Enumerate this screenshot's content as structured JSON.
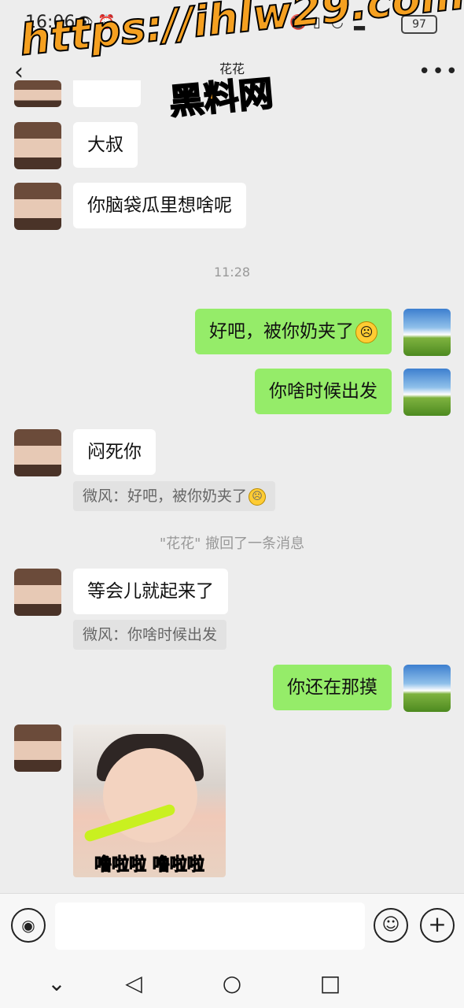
{
  "status_bar": {
    "time": "16:06",
    "battery": "97"
  },
  "header": {
    "title": "花花",
    "back_icon": "chevron-left-icon",
    "more_icon": "more-dots-icon"
  },
  "watermark": {
    "line1": "https://ihlw29.com",
    "line2": "黑料网"
  },
  "messages": [
    {
      "side": "left",
      "text": "大叔"
    },
    {
      "side": "left",
      "text": "你脑袋瓜里想啥呢"
    },
    {
      "type": "timestamp",
      "text": "11:28"
    },
    {
      "side": "right",
      "text": "好吧，被你奶夹了",
      "emoji": "frown-emoji"
    },
    {
      "side": "right",
      "text": "你啥时候出发"
    },
    {
      "side": "left",
      "text": "闷死你",
      "quote": "微风：好吧，被你奶夹了",
      "quote_emoji": "frown-emoji"
    },
    {
      "type": "system",
      "text": "\"花花\" 撤回了一条消息"
    },
    {
      "side": "left",
      "text": "等会儿就起来了",
      "quote": "微风：你啥时候出发"
    },
    {
      "side": "right",
      "text": "你还在那摸"
    },
    {
      "side": "left",
      "type": "sticker",
      "caption": "噜啦啦 噜啦啦"
    }
  ],
  "input_bar": {
    "voice_icon": "voice-icon",
    "emoji_icon": "smiley-icon",
    "plus_icon": "plus-icon",
    "input_value": ""
  },
  "nav_bar": {
    "icons": [
      "chevron-down-icon",
      "back-triangle-icon",
      "home-circle-icon",
      "recents-square-icon"
    ]
  },
  "colors": {
    "background": "#ededed",
    "bubble_right": "#95ec69",
    "bubble_left": "#ffffff",
    "watermark": "#f5a020"
  }
}
